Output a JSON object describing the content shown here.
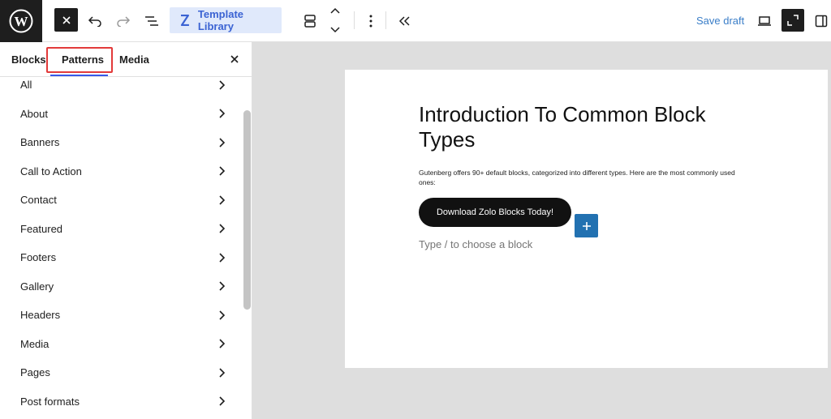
{
  "toolbar": {
    "template_library_label": "Template Library",
    "save_draft_label": "Save draft"
  },
  "inserter_panel": {
    "tabs": [
      {
        "label": "Blocks"
      },
      {
        "label": "Patterns"
      },
      {
        "label": "Media"
      }
    ],
    "active_tab": "Patterns",
    "categories": [
      {
        "label": "All"
      },
      {
        "label": "About"
      },
      {
        "label": "Banners"
      },
      {
        "label": "Call to Action"
      },
      {
        "label": "Contact"
      },
      {
        "label": "Featured"
      },
      {
        "label": "Footers"
      },
      {
        "label": "Gallery"
      },
      {
        "label": "Headers"
      },
      {
        "label": "Media"
      },
      {
        "label": "Pages"
      },
      {
        "label": "Post formats"
      }
    ]
  },
  "document": {
    "title": "Introduction To Common Block Types",
    "paragraph": "Gutenberg offers 90+ default blocks, categorized into different types. Here are the most commonly used ones:",
    "button_label": "Download Zolo Blocks Today!",
    "placeholder": "Type / to choose a block"
  },
  "colors": {
    "accent": "#3858e9",
    "highlight_border": "#e23a3a",
    "inserter_blue": "#2271b1",
    "template_library_bg": "#e0e9fb"
  }
}
